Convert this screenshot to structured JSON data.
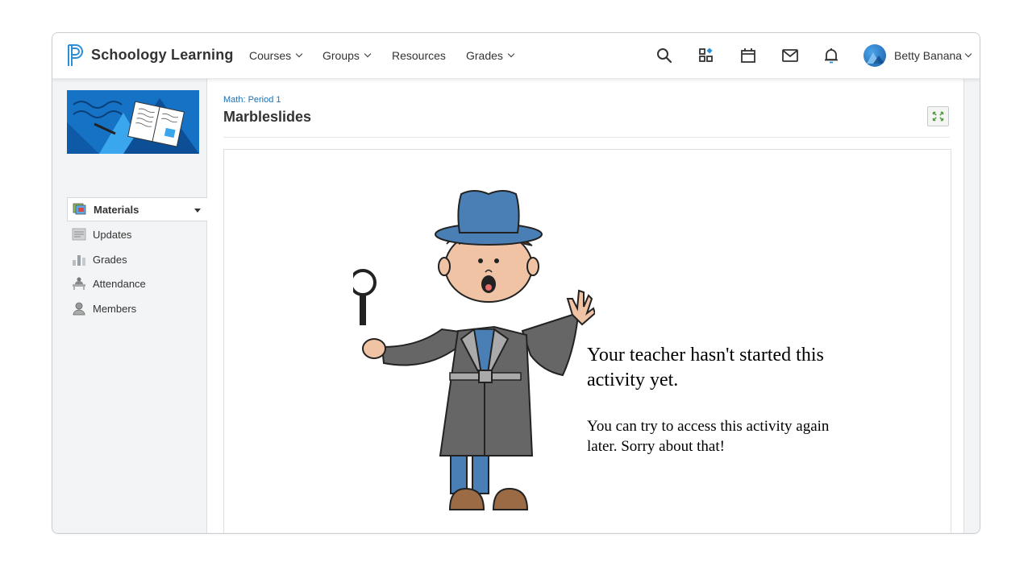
{
  "app": {
    "brand": "Schoology Learning"
  },
  "nav": {
    "courses": "Courses",
    "groups": "Groups",
    "resources": "Resources",
    "grades": "Grades",
    "user_name": "Betty Banana"
  },
  "sidebar": {
    "items": [
      {
        "label": "Materials",
        "icon": "materials-icon"
      },
      {
        "label": "Updates",
        "icon": "updates-icon"
      },
      {
        "label": "Grades",
        "icon": "grades-icon"
      },
      {
        "label": "Attendance",
        "icon": "attendance-icon"
      },
      {
        "label": "Members",
        "icon": "members-icon"
      }
    ]
  },
  "main": {
    "breadcrumb": "Math: Period 1",
    "title": "Marbleslides",
    "message_heading": "Your teacher hasn't started this activity yet.",
    "message_body": "You can try to access this activity again later. Sorry about that!"
  },
  "colors": {
    "brand_blue": "#1a6fb3",
    "course_banner": "#1572c4",
    "detective_hat": "#4a7fb5",
    "coat": "#666666"
  }
}
